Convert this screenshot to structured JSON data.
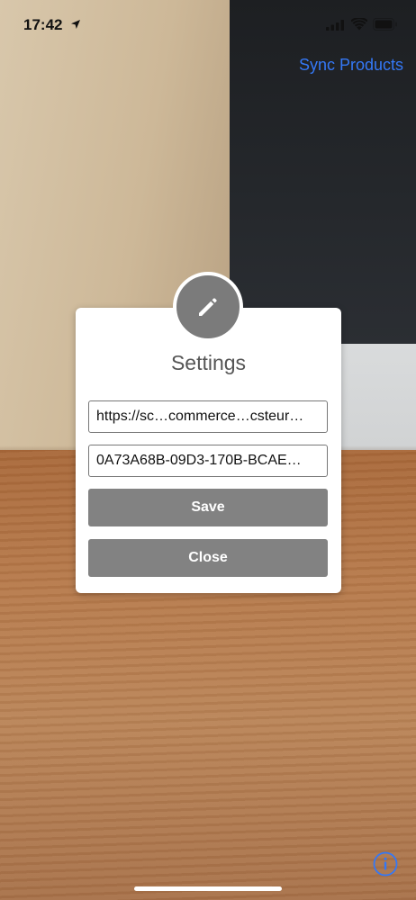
{
  "status_bar": {
    "time": "17:42",
    "icons": [
      "location-arrow-icon",
      "cellular-signal-icon",
      "wifi-icon",
      "battery-icon"
    ]
  },
  "header": {
    "sync_label": "Sync Products"
  },
  "dialog": {
    "icon": "pencil-icon",
    "title": "Settings",
    "url_value": "https://sc…commerce…csteur…",
    "key_value": "0A73A68B-09D3-170B-BCAE…",
    "save_label": "Save",
    "close_label": "Close"
  },
  "footer": {
    "info_icon": "info-icon"
  },
  "colors": {
    "accent": "#3478f6",
    "button": "#828282",
    "avatar": "#7b7b7b",
    "title_text": "#555555"
  }
}
